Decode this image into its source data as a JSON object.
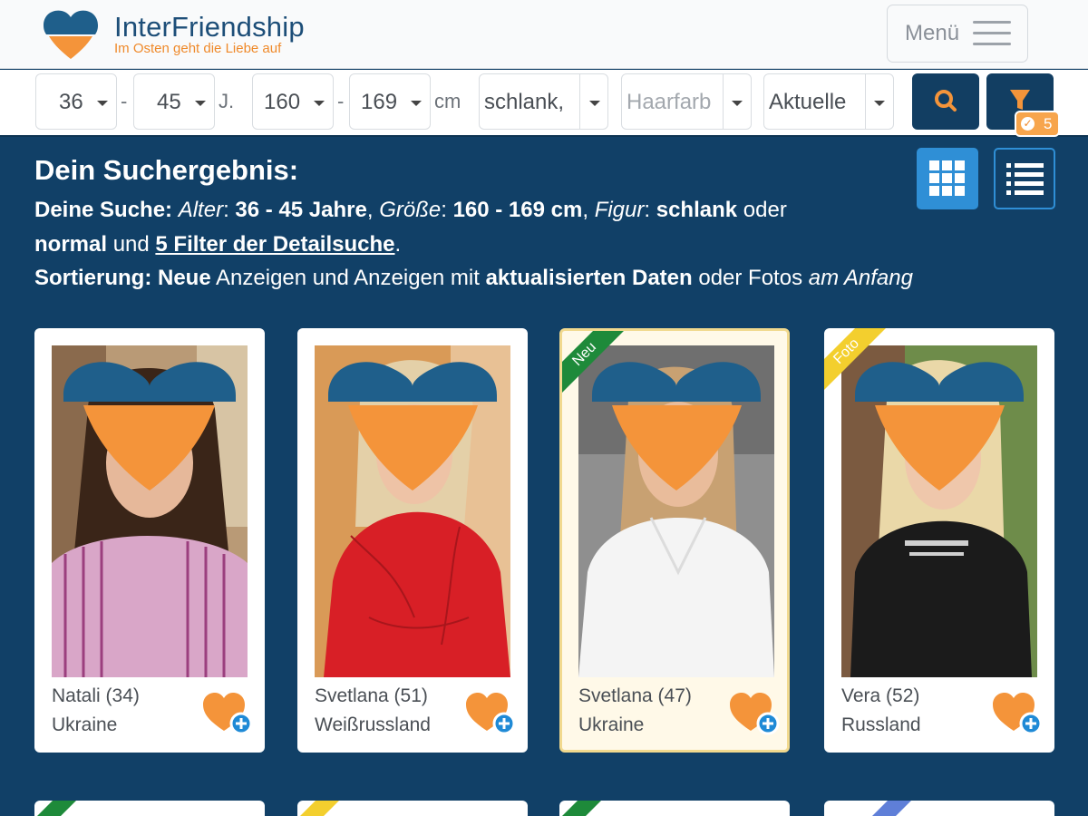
{
  "header": {
    "brand": "InterFriendship",
    "tagline": "Im Osten geht die Liebe auf",
    "menu_label": "Menü"
  },
  "search": {
    "age_from": "36",
    "age_to": "45",
    "age_unit": "J.",
    "height_from": "160",
    "height_to": "169",
    "height_unit": "cm",
    "figure": "schlank,",
    "hair_placeholder": "Haarfarb",
    "sort": "Aktuelle",
    "separator": "-",
    "filter_count": "5",
    "search_icon": "search-icon",
    "filter_icon": "filter-icon"
  },
  "results": {
    "title": "Dein Suchergebnis:",
    "line1": {
      "lead": "Deine Suche:",
      "age_key": "Alter",
      "colon": ":",
      "age_val": "36 - 45 Jahre",
      "comma": ",",
      "height_key": "Größe",
      "height_val": "160 - 169 cm",
      "figure_key": "Figur",
      "figure_val": "schlank",
      "oder": "oder"
    },
    "line2": {
      "normal": "normal",
      "und": "und",
      "link": "5 Filter der Detailsuche",
      "dot": "."
    },
    "line3": {
      "lead": "Sortierung:",
      "neue": "Neue",
      "mid": "Anzeigen und Anzeigen mit",
      "akt": "aktualisierten Daten",
      "tail": "oder Fotos",
      "end": "am Anfang"
    }
  },
  "profiles": [
    {
      "name": "Natali (34)",
      "country": "Ukraine",
      "ribbon": ""
    },
    {
      "name": "Svetlana (51)",
      "country": "Weißrussland",
      "ribbon": ""
    },
    {
      "name": "Svetlana (47)",
      "country": "Ukraine",
      "ribbon": "Neu"
    },
    {
      "name": "Vera (52)",
      "country": "Russland",
      "ribbon": "Foto"
    }
  ],
  "colors": {
    "brand_dark": "#123e62",
    "background": "#114067",
    "accent_orange": "#f4943a",
    "heart_blue": "#1f5f8b",
    "ribbon_new": "#1e8a3a",
    "ribbon_photo": "#f3cf2e",
    "view_grid_active": "#2f8fd6"
  }
}
